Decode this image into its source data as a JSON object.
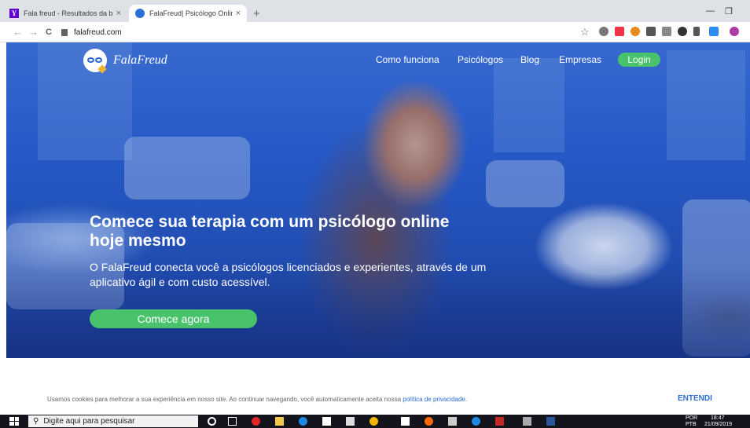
{
  "browser": {
    "tabs": [
      {
        "title": "Fala freud - Resultados da busca",
        "close": "×"
      },
      {
        "title": "FalaFreud| Psicólogo Online | Ta",
        "close": "×"
      }
    ],
    "new_tab": "+",
    "url": "falafreud.com",
    "controls": {
      "minimize": "—",
      "maximize": "❐",
      "back": "←",
      "forward": "→",
      "reload": "C",
      "star": "☆"
    }
  },
  "site": {
    "logo_text": "FalaFreud",
    "nav": [
      "Como funciona",
      "Psicólogos",
      "Blog",
      "Empresas"
    ],
    "login": "Login",
    "headline_line1": "Comece sua terapia com um psicólogo online",
    "headline_line2": "hoje mesmo",
    "sub_line1": "O FalaFreud conecta você a psicólogos licenciados e experientes, através de um",
    "sub_line2": "aplicativo ágil e com custo acessível.",
    "cta": "Comece agora"
  },
  "cookie": {
    "text": "Usamos cookies para melhorar a sua experiência em nosso site. Ao continuar navegando, você automaticamente aceita nossa ",
    "link": "política de privacidade",
    "dot": ".",
    "button": "ENTENDI"
  },
  "taskbar": {
    "search_placeholder": "Digite aqui para pesquisar",
    "lang_top": "POR",
    "lang_bottom": "PTB",
    "time": "18:47",
    "date": "21/09/2019"
  },
  "colors": {
    "accent_green": "#49c36b",
    "brand_blue": "#2b6bd8"
  }
}
